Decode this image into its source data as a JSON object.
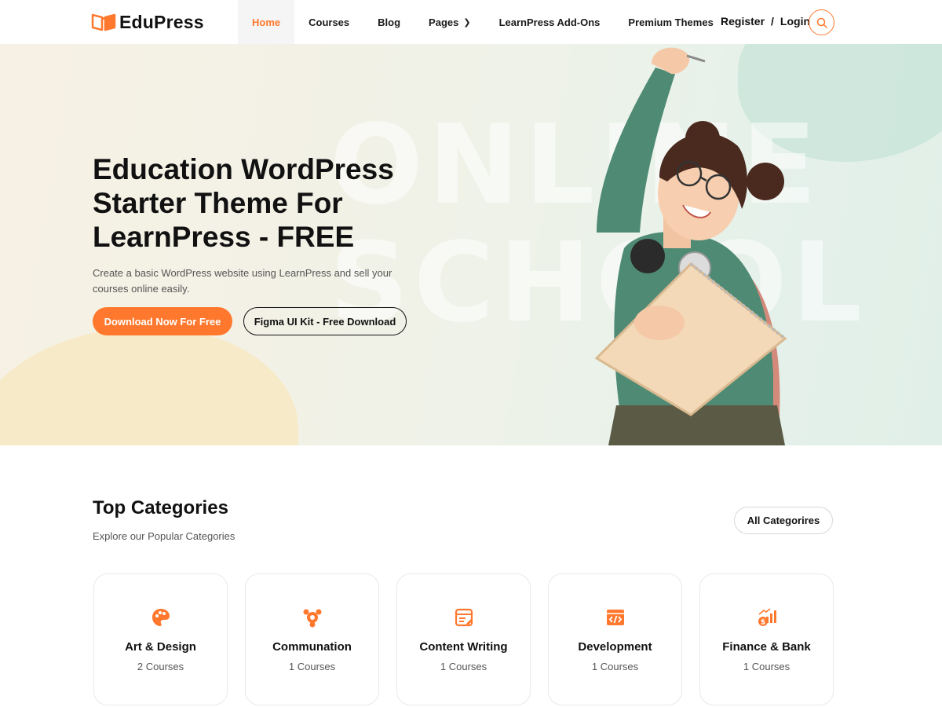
{
  "brand": {
    "name": "EduPress",
    "accent": "#ff782d"
  },
  "nav": [
    {
      "label": "Home",
      "active": true
    },
    {
      "label": "Courses"
    },
    {
      "label": "Blog"
    },
    {
      "label": "Pages",
      "has_submenu": true
    },
    {
      "label": "LearnPress Add-Ons"
    },
    {
      "label": "Premium Themes"
    }
  ],
  "auth": {
    "register": "Register",
    "separator": "/",
    "login": "Login"
  },
  "hero": {
    "title": "Education WordPress Starter Theme For LearnPress - FREE",
    "subtitle": "Create a basic WordPress website using LearnPress and sell your courses online easily.",
    "primary_button": "Download Now For Free",
    "secondary_button": "Figma UI Kit - Free Download",
    "watermark_line1": "ONLINE",
    "watermark_line2": "SCHOOL"
  },
  "categories": {
    "title": "Top Categories",
    "subtitle": "Explore our Popular Categories",
    "all_button": "All Categorires",
    "items": [
      {
        "name": "Art & Design",
        "count": "2 Courses",
        "icon": "palette-icon"
      },
      {
        "name": "Communation",
        "count": "1 Courses",
        "icon": "communication-icon"
      },
      {
        "name": "Content Writing",
        "count": "1 Courses",
        "icon": "writing-icon"
      },
      {
        "name": "Development",
        "count": "1 Courses",
        "icon": "code-icon"
      },
      {
        "name": "Finance & Bank",
        "count": "1 Courses",
        "icon": "finance-icon"
      }
    ]
  }
}
